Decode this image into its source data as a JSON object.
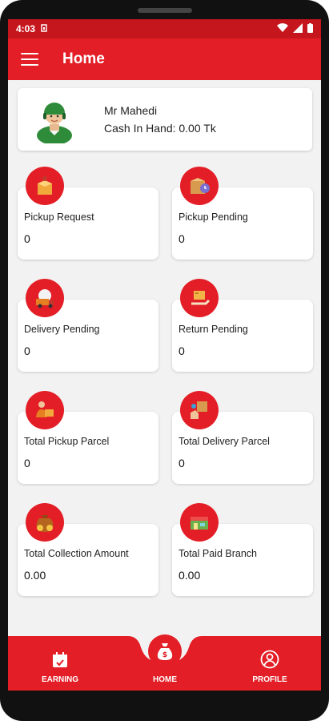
{
  "status_bar": {
    "time": "4:03"
  },
  "app_bar": {
    "title": "Home"
  },
  "profile": {
    "name": "Mr Mahedi",
    "cash_label": "Cash In Hand: 0.00 Tk"
  },
  "cards": [
    {
      "label": "Pickup Request",
      "value": "0",
      "icon": "pickup-request-icon"
    },
    {
      "label": "Pickup Pending",
      "value": "0",
      "icon": "pickup-pending-icon"
    },
    {
      "label": "Delivery Pending",
      "value": "0",
      "icon": "delivery-pending-icon"
    },
    {
      "label": "Return Pending",
      "value": "0",
      "icon": "return-pending-icon"
    },
    {
      "label": "Total Pickup Parcel",
      "value": "0",
      "icon": "total-pickup-parcel-icon"
    },
    {
      "label": "Total Delivery Parcel",
      "value": "0",
      "icon": "total-delivery-parcel-icon"
    },
    {
      "label": "Total Collection Amount",
      "value": "0.00",
      "icon": "total-collection-amount-icon"
    },
    {
      "label": "Total Paid Branch",
      "value": "0.00",
      "icon": "total-paid-branch-icon"
    }
  ],
  "bottom_nav": {
    "earning": "EARNING",
    "home": "HOME",
    "profile": "PROFILE"
  },
  "colors": {
    "primary": "#e31e26",
    "status_bar": "#c6161d",
    "background": "#f2f2f2"
  }
}
